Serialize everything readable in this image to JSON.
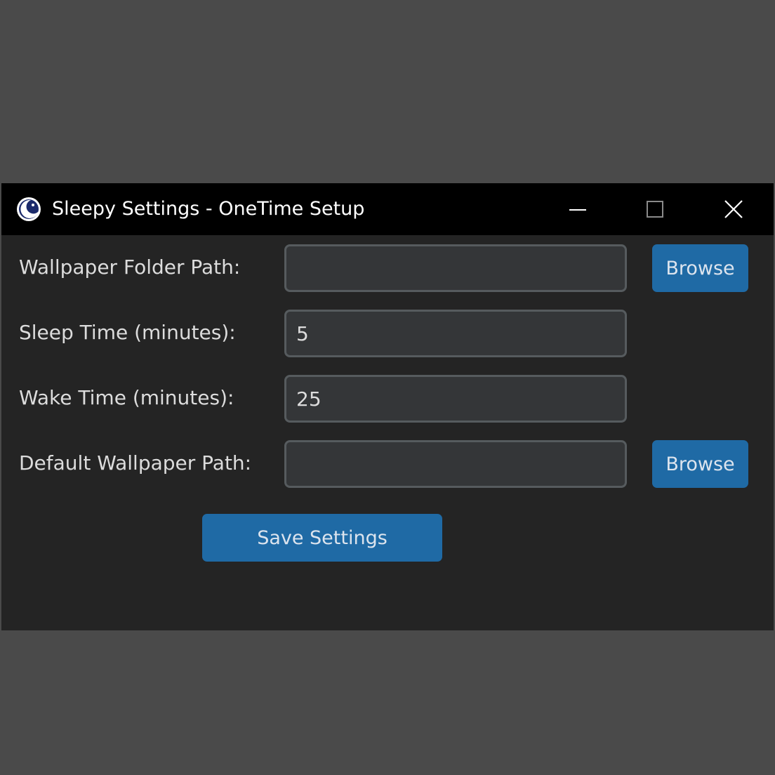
{
  "window": {
    "title": "Sleepy Settings - OneTime Setup",
    "controls": {
      "minimize_icon": "minimize-icon",
      "maximize_icon": "maximize-icon",
      "close_icon": "close-icon"
    }
  },
  "form": {
    "wallpaper_folder": {
      "label": "Wallpaper Folder Path:",
      "value": "",
      "browse_label": "Browse"
    },
    "sleep_time": {
      "label": "Sleep Time (minutes):",
      "value": "5"
    },
    "wake_time": {
      "label": "Wake Time (minutes):",
      "value": "25"
    },
    "default_wallpaper": {
      "label": "Default Wallpaper Path:",
      "value": "",
      "browse_label": "Browse"
    },
    "save_label": "Save Settings"
  },
  "colors": {
    "accent": "#1f6aa5",
    "background": "#242424",
    "field_bg": "#343638",
    "field_border": "#565b5e",
    "titlebar": "#000000"
  }
}
